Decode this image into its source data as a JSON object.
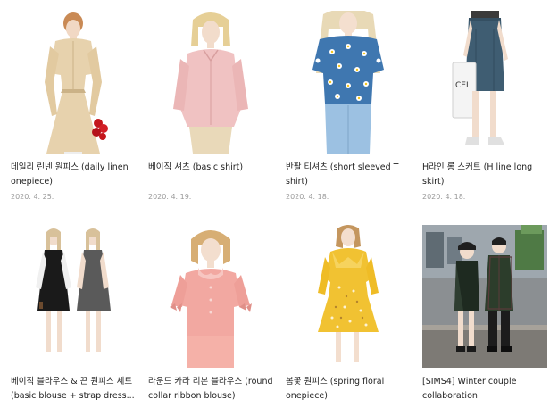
{
  "posts": [
    {
      "title": "데일리 린넨 원피스 (daily linen onepiece)",
      "date": "2020. 4. 25.",
      "icon": "linen-dress-image"
    },
    {
      "title": "베이직 셔츠 (basic shirt)",
      "date": "2020. 4. 19.",
      "icon": "basic-shirt-image"
    },
    {
      "title": "반팔 티셔츠 (short sleeved T shirt)",
      "date": "2020. 4. 18.",
      "icon": "daisy-tshirt-image"
    },
    {
      "title": "H라인 롱 스커트 (H line long skirt)",
      "date": "2020. 4. 18.",
      "icon": "long-skirt-image"
    },
    {
      "title": "베이직 블라우스 & 끈 원피스 세트 (basic blouse + strap dress...",
      "icon": "blouse-strap-dress-image"
    },
    {
      "title": "라운드 카라 리본 블라우스 (round collar ribbon blouse)",
      "icon": "ribbon-blouse-image"
    },
    {
      "title": "봄꽃 원피스 (spring floral onepiece)",
      "icon": "floral-dress-image"
    },
    {
      "title": "[SIMS4] Winter couple collaboration",
      "icon": "winter-couple-image"
    }
  ]
}
